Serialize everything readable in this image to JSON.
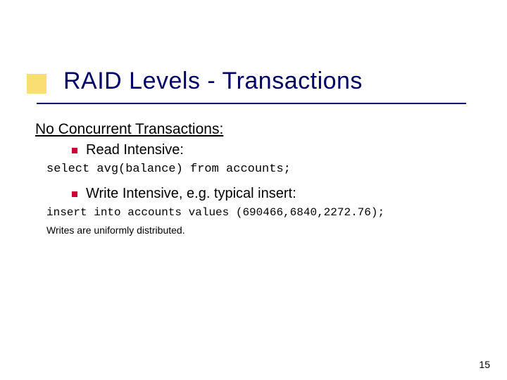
{
  "title": "RAID Levels - Transactions",
  "section_heading": "No Concurrent Transactions:",
  "bullets": {
    "b1": "Read Intensive:",
    "b2": "Write Intensive, e.g. typical insert:"
  },
  "code": {
    "c1": "select avg(balance) from accounts;",
    "c2": "insert into accounts values (690466,6840,2272.76);"
  },
  "note": "Writes are uniformly distributed.",
  "page_number": "15"
}
